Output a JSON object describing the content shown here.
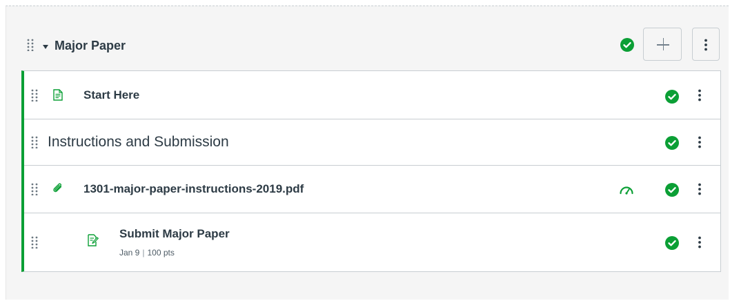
{
  "module": {
    "title": "Major Paper",
    "status": "published",
    "add_button_icon": "plus-icon",
    "menu_icon": "kebab-icon"
  },
  "items": [
    {
      "kind": "page",
      "icon": "page-icon",
      "title": "Start Here",
      "status": "published"
    },
    {
      "kind": "subheader",
      "title": "Instructions and Submission",
      "status": "published"
    },
    {
      "kind": "file",
      "icon": "paperclip-icon",
      "title": "1301-major-paper-instructions-2019.pdf",
      "extra_icon": "mastery-paths-icon",
      "status": "published"
    },
    {
      "kind": "assignment",
      "icon": "assignment-icon",
      "title": "Submit Major Paper",
      "due": "Jan 9",
      "separator": "|",
      "points": "100 pts",
      "status": "published"
    }
  ],
  "colors": {
    "published_green": "#0b9f35",
    "text": "#2d3b45",
    "border": "#c7cdd1",
    "module_bg": "#f5f5f5"
  }
}
